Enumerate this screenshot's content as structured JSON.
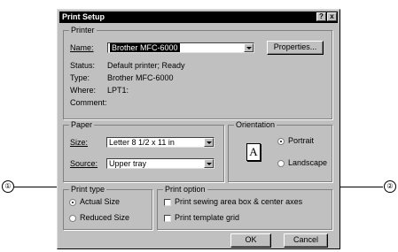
{
  "dialog": {
    "title": "Print Setup",
    "help_button": "?",
    "close_button": "x"
  },
  "printer": {
    "group_label": "Printer",
    "name_label": "Name:",
    "name_value": "Brother MFC-6000",
    "properties_button": "Properties...",
    "status_label": "Status:",
    "status_value": "Default printer; Ready",
    "type_label": "Type:",
    "type_value": "Brother MFC-6000",
    "where_label": "Where:",
    "where_value": "LPT1:",
    "comment_label": "Comment:"
  },
  "paper": {
    "group_label": "Paper",
    "size_label": "Size:",
    "size_value": "Letter 8 1/2 x 11 in",
    "source_label": "Source:",
    "source_value": "Upper tray"
  },
  "orientation": {
    "group_label": "Orientation",
    "portrait_label": "Portrait",
    "landscape_label": "Landscape",
    "selected": "Portrait",
    "icon_letter": "A"
  },
  "print_type": {
    "group_label": "Print type",
    "actual_size_label": "Actual Size",
    "reduced_size_label": "Reduced Size",
    "selected": "Actual Size"
  },
  "print_option": {
    "group_label": "Print option",
    "sewing_area_label": "Print sewing area box & center axes",
    "template_grid_label": "Print template grid"
  },
  "buttons": {
    "ok": "OK",
    "cancel": "Cancel"
  },
  "callouts": {
    "left": "①",
    "right": "②"
  }
}
